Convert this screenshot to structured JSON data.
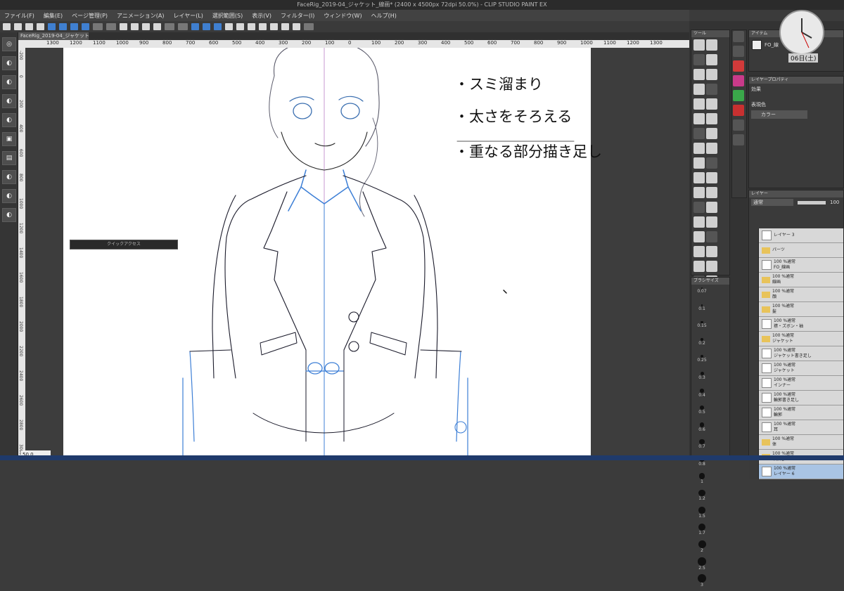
{
  "window": {
    "title": "FaceRig_2019-04_ジャケット_線画* (2400 x 4500px 72dpi 50.0%) - CLIP STUDIO PAINT EX"
  },
  "menu": [
    "ファイル(F)",
    "編集(E)",
    "ページ管理(P)",
    "アニメーション(A)",
    "レイヤー(L)",
    "選択範囲(S)",
    "表示(V)",
    "フィルター(I)",
    "ウィンドウ(W)",
    "ヘルプ(H)"
  ],
  "document": {
    "tab": "FaceRig_2019-04_ジャケット_線画*",
    "zoom": "50.0"
  },
  "ruler": {
    "top": [
      "1300",
      "1200",
      "1100",
      "1000",
      "900",
      "800",
      "700",
      "600",
      "500",
      "400",
      "300",
      "200",
      "100",
      "0",
      "100",
      "200",
      "300",
      "400",
      "500",
      "600",
      "700",
      "800",
      "900",
      "1000",
      "1100",
      "1200",
      "1300"
    ],
    "left": [
      "-200",
      "0",
      "200",
      "400",
      "600",
      "800",
      "1000",
      "1200",
      "1400",
      "1600",
      "1800",
      "2000",
      "2200",
      "2400",
      "2600",
      "2800",
      "3000"
    ]
  },
  "notes": [
    "・スミ溜まり",
    "・太さをそろえる",
    "・重なる部分描き足し"
  ],
  "quick_access": {
    "title": "クイックアクセス"
  },
  "tool_panel": {
    "title": "ツール"
  },
  "subtool_panel": {
    "title": "アイテム"
  },
  "brush_size": {
    "title": "ブラシサイズ",
    "sizes": [
      "0.07",
      "0.1",
      "0.15",
      "0.2",
      "0.25",
      "0.3",
      "0.4",
      "0.5",
      "0.6",
      "0.7",
      "0.8",
      "1",
      "1.2",
      "1.5",
      "1.7",
      "2",
      "2.5",
      "3"
    ]
  },
  "layer_property": {
    "title": "レイヤープロパティ",
    "effect_label": "効果",
    "expression_label": "表現色",
    "expression_value": "カラー"
  },
  "nav_item": {
    "label": "FO_線"
  },
  "layer_panel": {
    "title": "レイヤー",
    "blend_mode": "通常",
    "opacity": "100",
    "layers": [
      {
        "line1": "",
        "line2": "レイヤー 3",
        "kind": "layer"
      },
      {
        "line1": "",
        "line2": "パーツ",
        "kind": "folder"
      },
      {
        "line1": "100 %通常",
        "line2": "FO_線画",
        "kind": "layer"
      },
      {
        "line1": "100 %通常",
        "line2": "線画",
        "kind": "folder"
      },
      {
        "line1": "100 %通常",
        "line2": "顔",
        "kind": "folder"
      },
      {
        "line1": "100 %通常",
        "line2": "髪",
        "kind": "folder"
      },
      {
        "line1": "100 %通常",
        "line2": "襟・ズボン・袖",
        "kind": "layer"
      },
      {
        "line1": "100 %通常",
        "line2": "ジャケット",
        "kind": "folder"
      },
      {
        "line1": "100 %通常",
        "line2": "ジャケット書き足し",
        "kind": "layer"
      },
      {
        "line1": "100 %通常",
        "line2": "ジャケット",
        "kind": "layer"
      },
      {
        "line1": "100 %通常",
        "line2": "インナー",
        "kind": "layer"
      },
      {
        "line1": "100 %通常",
        "line2": "輪郭書き足し",
        "kind": "layer"
      },
      {
        "line1": "100 %通常",
        "line2": "輪郭",
        "kind": "layer"
      },
      {
        "line1": "100 %通常",
        "line2": "耳",
        "kind": "layer"
      },
      {
        "line1": "100 %通常",
        "line2": "体",
        "kind": "folder"
      },
      {
        "line1": "100 %通常",
        "line2": "下描き",
        "kind": "folder"
      },
      {
        "line1": "100 %通常",
        "line2": "レイヤー 6",
        "kind": "layer"
      }
    ]
  },
  "clock": {
    "date": "06日(土)"
  },
  "colors": {
    "accent": "#3f7fd0",
    "paper": "#ffffff",
    "sketch_blue": "#3d7fd6",
    "line_dark": "#1a1a2a"
  }
}
